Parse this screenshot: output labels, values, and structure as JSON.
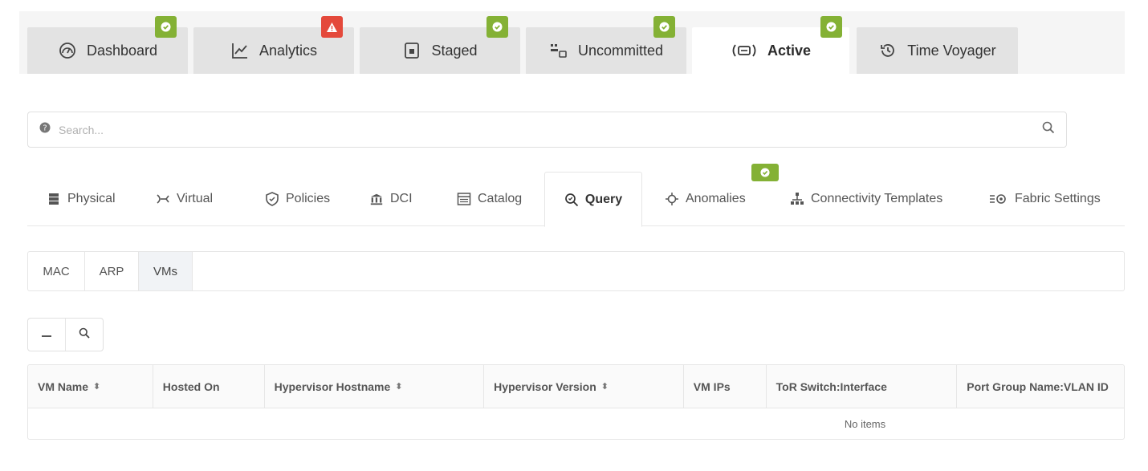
{
  "top_tabs": [
    {
      "label": "Dashboard",
      "icon": "dashboard-icon",
      "status": "ok"
    },
    {
      "label": "Analytics",
      "icon": "analytics-icon",
      "status": "warning"
    },
    {
      "label": "Staged",
      "icon": "staged-icon",
      "status": "ok"
    },
    {
      "label": "Uncommitted",
      "icon": "uncommitted-icon",
      "status": "ok"
    },
    {
      "label": "Active",
      "icon": "active-icon",
      "status": "ok",
      "active": true
    },
    {
      "label": "Time Voyager",
      "icon": "history-icon"
    }
  ],
  "search": {
    "placeholder": "Search..."
  },
  "section_tabs": [
    {
      "label": "Physical",
      "icon": "physical-icon"
    },
    {
      "label": "Virtual",
      "icon": "virtual-icon"
    },
    {
      "label": "Policies",
      "icon": "shield-icon"
    },
    {
      "label": "DCI",
      "icon": "dci-icon"
    },
    {
      "label": "Catalog",
      "icon": "catalog-icon"
    },
    {
      "label": "Query",
      "icon": "query-icon",
      "active": true
    },
    {
      "label": "Anomalies",
      "icon": "anomalies-icon",
      "status": "ok"
    },
    {
      "label": "Connectivity Templates",
      "icon": "connectivity-icon"
    },
    {
      "label": "Fabric Settings",
      "icon": "fabric-settings-icon"
    }
  ],
  "sub_tabs": [
    {
      "label": "MAC"
    },
    {
      "label": "ARP"
    },
    {
      "label": "VMs",
      "active": true
    }
  ],
  "table": {
    "columns": [
      {
        "label": "VM Name",
        "sortable": true
      },
      {
        "label": "Hosted On",
        "sortable": false
      },
      {
        "label": "Hypervisor Hostname",
        "sortable": true
      },
      {
        "label": "Hypervisor Version",
        "sortable": true
      },
      {
        "label": "VM IPs",
        "sortable": false
      },
      {
        "label": "ToR Switch:Interface",
        "sortable": false
      },
      {
        "label": "Port Group Name:VLAN ID",
        "sortable": false
      }
    ],
    "empty_text": "No items",
    "sort_glyph": "⬍"
  },
  "colors": {
    "ok_badge": "#84b135",
    "error_badge": "#e4493b",
    "tab_bg": "#e3e3e3"
  }
}
